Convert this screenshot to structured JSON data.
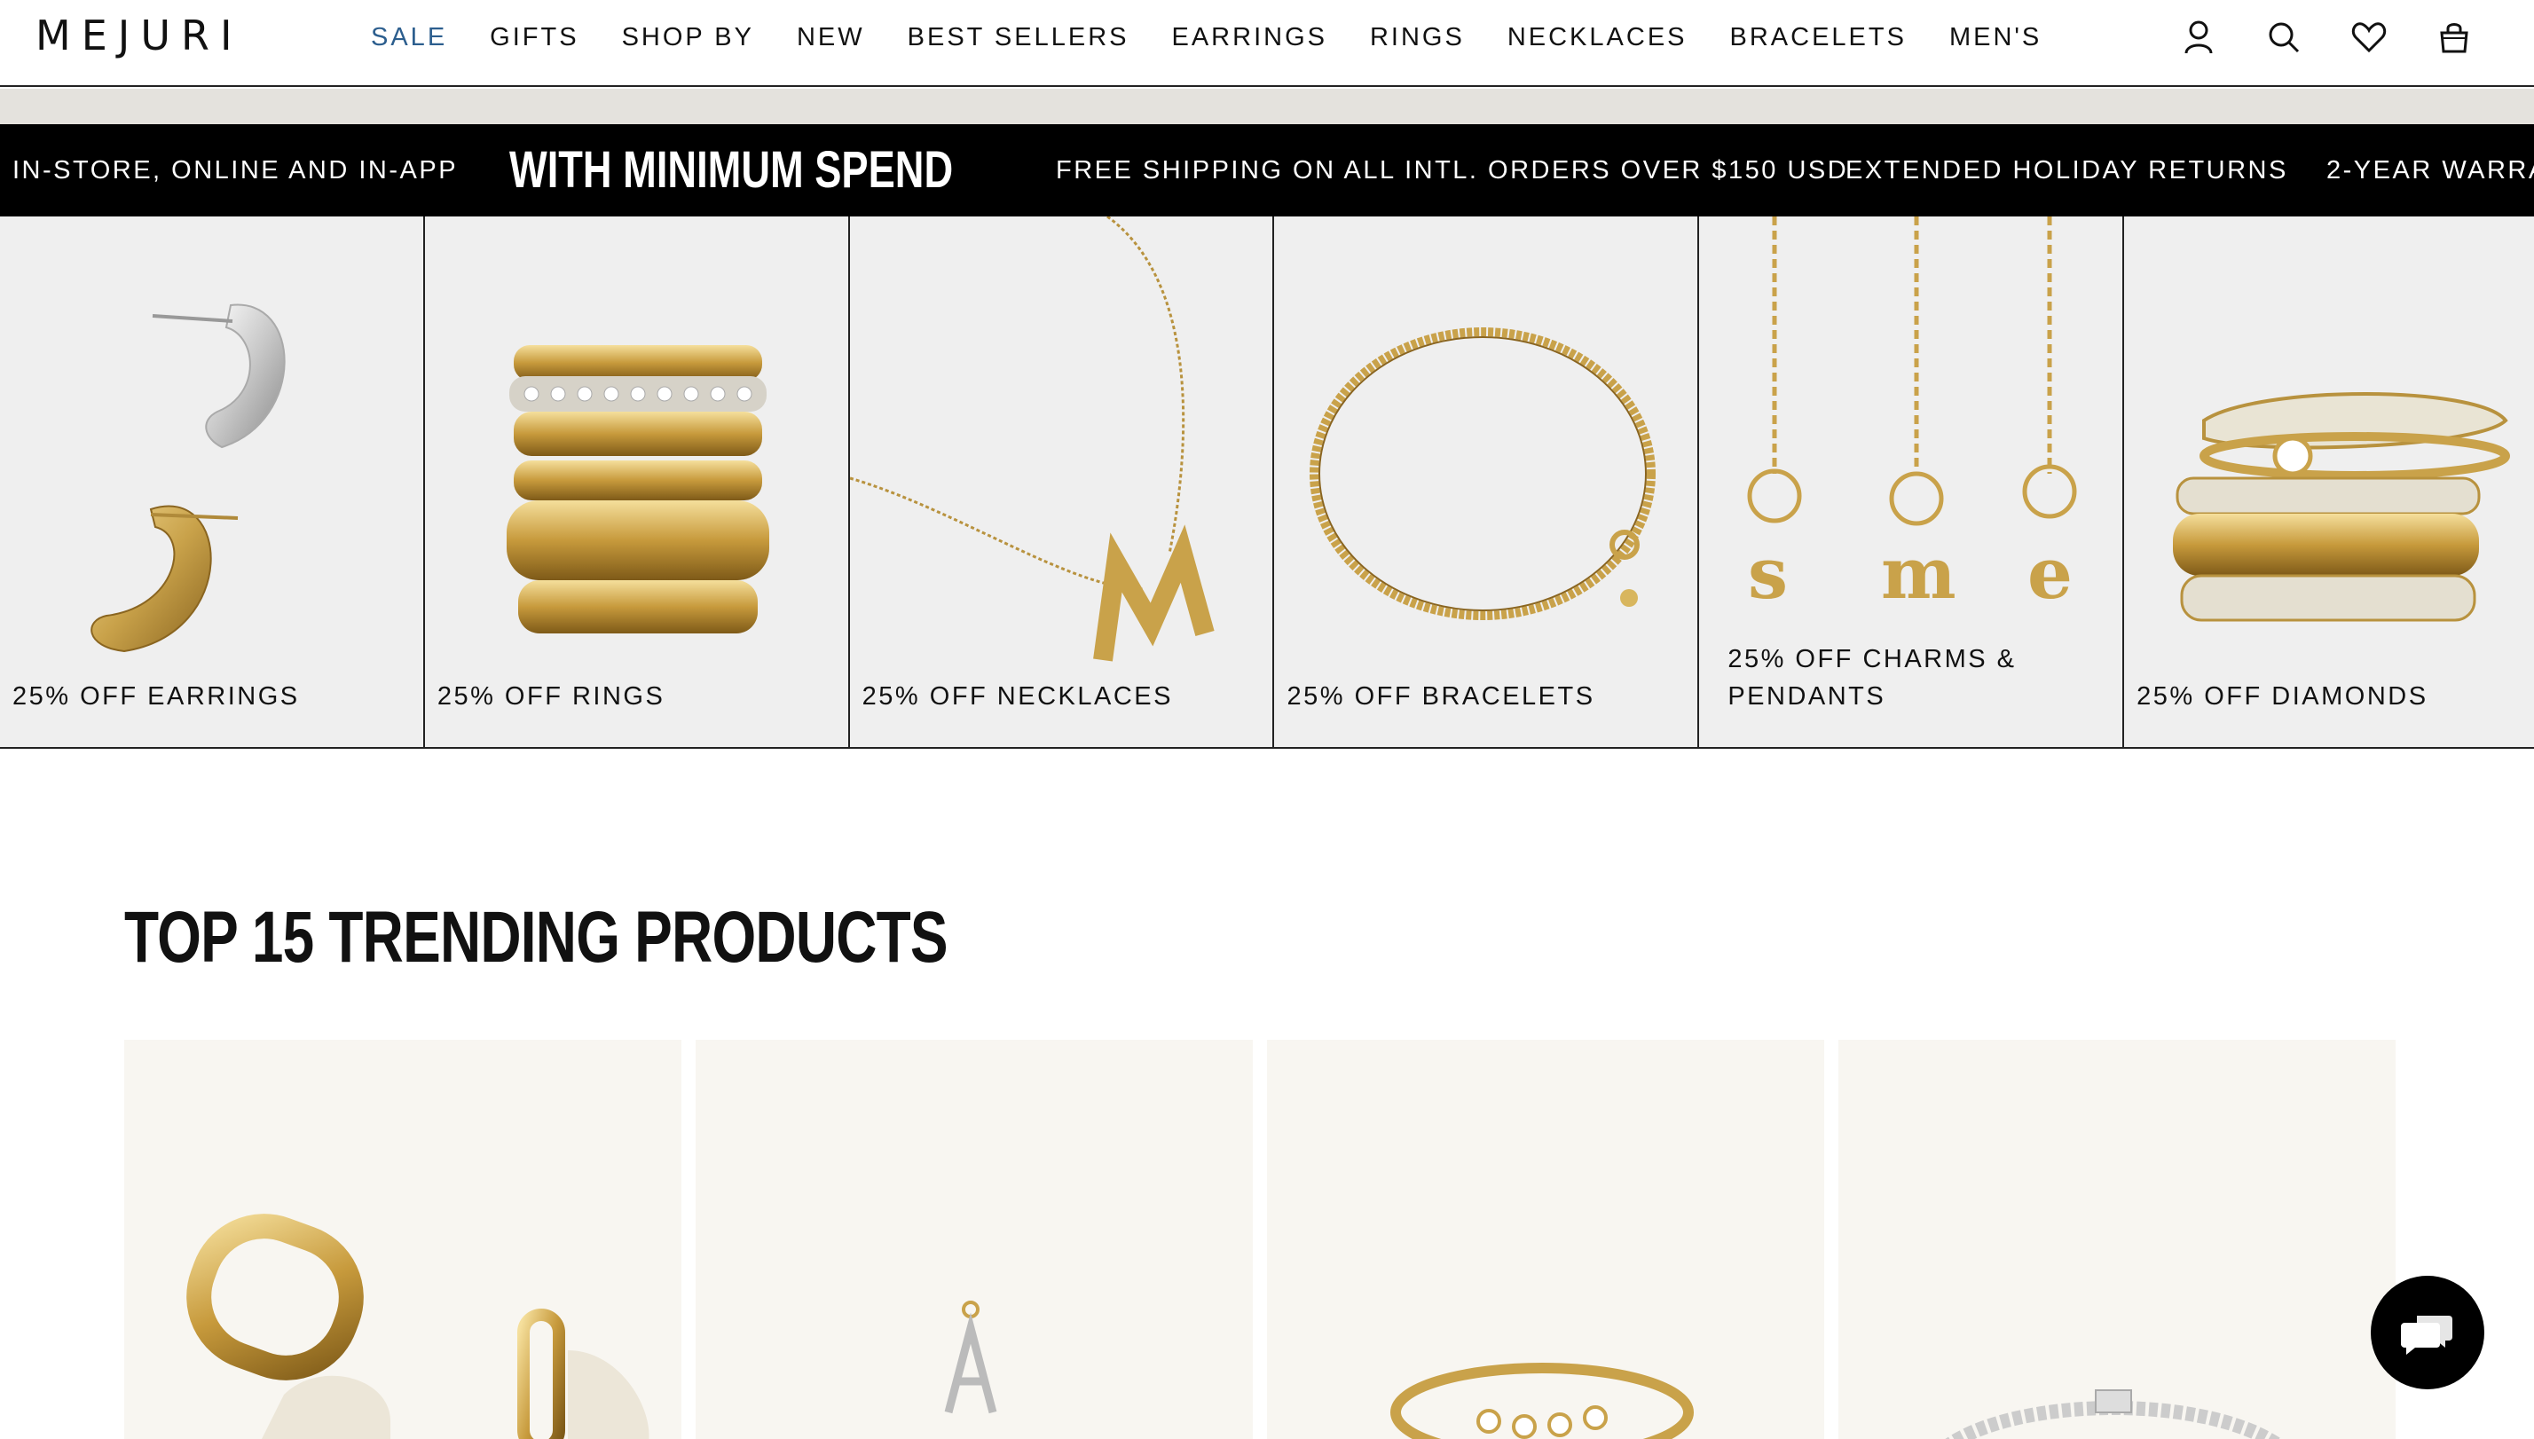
{
  "header": {
    "logo": "MEJURI",
    "nav": [
      {
        "label": "SALE",
        "active": true
      },
      {
        "label": "GIFTS"
      },
      {
        "label": "SHOP BY"
      },
      {
        "label": "NEW"
      },
      {
        "label": "BEST SELLERS"
      },
      {
        "label": "EARRINGS"
      },
      {
        "label": "RINGS"
      },
      {
        "label": "NECKLACES"
      },
      {
        "label": "BRACELETS"
      },
      {
        "label": "MEN'S"
      }
    ],
    "icons": [
      "account-icon",
      "search-icon",
      "wishlist-heart-icon",
      "shopping-bag-icon"
    ]
  },
  "promo_bar": {
    "items": [
      "IN-STORE, ONLINE AND IN-APP",
      "WITH MINIMUM SPEND",
      "FREE SHIPPING ON ALL INTL. ORDERS OVER $150 USD",
      "EXTENDED HOLIDAY RETURNS",
      "2-YEAR WARRAN"
    ]
  },
  "categories": [
    {
      "label": "25% OFF EARRINGS"
    },
    {
      "label": "25% OFF RINGS"
    },
    {
      "label": "25% OFF NECKLACES"
    },
    {
      "label": "25% OFF BRACELETS"
    },
    {
      "label": "25% OFF CHARMS & PENDANTS"
    },
    {
      "label": "25% OFF DIAMONDS"
    }
  ],
  "trending": {
    "title": "TOP 15 TRENDING PRODUCTS"
  },
  "colors": {
    "active_nav": "#2c5e8e",
    "promo_bg": "#000000",
    "tile_bg": "#efefef",
    "product_bg": "#f8f6f1",
    "gold": "#c9a24a"
  },
  "chat": {
    "icon": "chat-bubble-icon"
  }
}
